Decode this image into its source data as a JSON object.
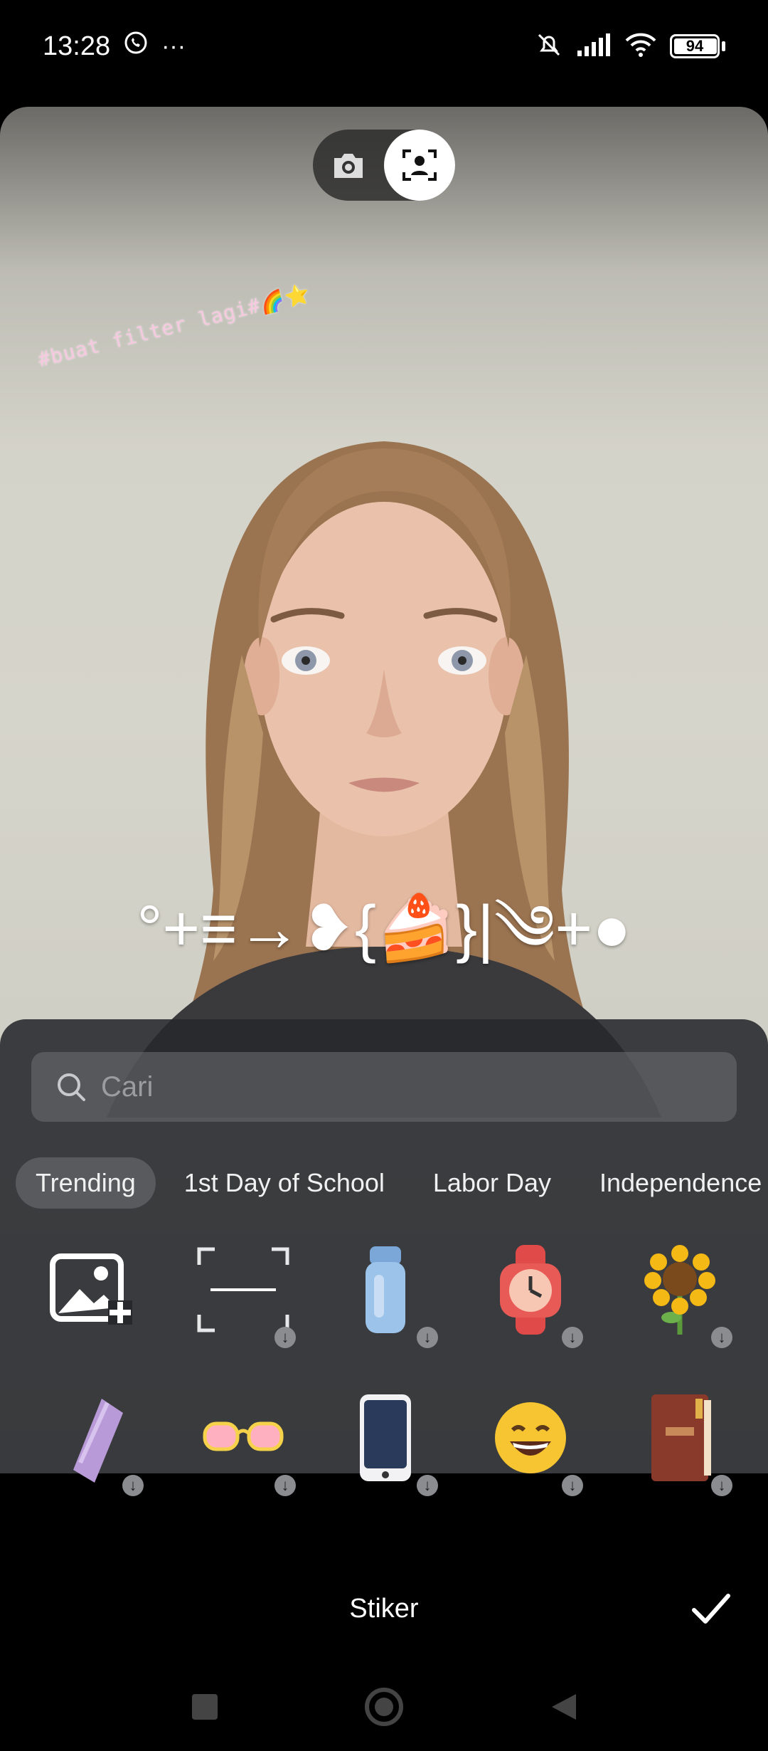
{
  "status_bar": {
    "time": "13:28",
    "battery": "94",
    "more": "···"
  },
  "preview": {
    "caption": "#buat filter lagi#🌈⭐",
    "sticker_text": "°+≡→❥{🍰}|༄+●"
  },
  "panel": {
    "search_placeholder": "Cari",
    "tabs": [
      "Trending",
      "1st Day of School",
      "Labor Day",
      "Independence"
    ],
    "row1": [
      {
        "icon": "add-image-icon",
        "emoji": ""
      },
      {
        "icon": "face-frame-sticker-icon",
        "emoji": ""
      },
      {
        "icon": "water-bottle-sticker-icon",
        "emoji": "🧴"
      },
      {
        "icon": "watch-sticker-icon",
        "emoji": "⌚"
      },
      {
        "icon": "sunflower-sticker-icon",
        "emoji": "🌻"
      }
    ],
    "row2": [
      {
        "icon": "umbrella-sticker-icon",
        "emoji": "☂️"
      },
      {
        "icon": "sunglasses-sticker-icon",
        "emoji": "🕶️"
      },
      {
        "icon": "phone-sticker-icon",
        "emoji": "📱"
      },
      {
        "icon": "grinning-face-sticker-icon",
        "emoji": "😄"
      },
      {
        "icon": "book-sticker-icon",
        "emoji": "📕"
      }
    ]
  },
  "bottom_bar": {
    "title": "Stiker"
  }
}
